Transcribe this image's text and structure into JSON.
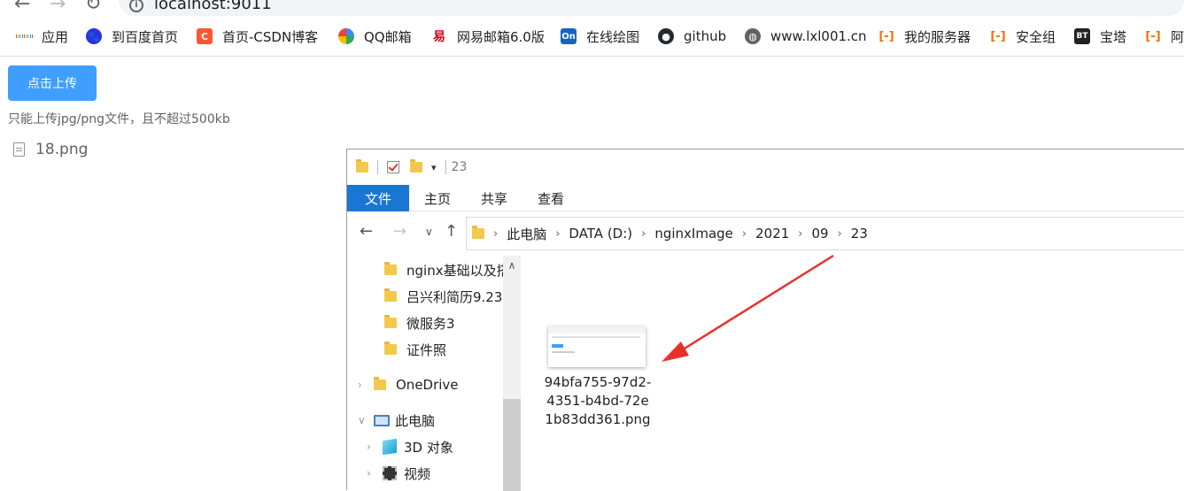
{
  "browser": {
    "url": "localhost:9011",
    "bookmarks": [
      {
        "label": "应用",
        "icon": "apps-grid-icon"
      },
      {
        "label": "到百度首页",
        "icon": "baidu-paw-icon",
        "color": "#2932e1"
      },
      {
        "label": "首页-CSDN博客",
        "icon": "csdn-icon",
        "color": "#fc5531",
        "glyph": "C"
      },
      {
        "label": "QQ邮箱",
        "icon": "qq-mail-icon",
        "color": "#f5a623"
      },
      {
        "label": "网易邮箱6.0版",
        "icon": "netease-mail-icon",
        "color": "#d0021b"
      },
      {
        "label": "在线绘图",
        "icon": "online-draw-icon",
        "color": "#1565c0",
        "glyph": "On"
      },
      {
        "label": "github",
        "icon": "github-icon",
        "color": "#24292e"
      },
      {
        "label": "www.lxl001.cn",
        "icon": "globe-icon",
        "color": "#5f6368"
      },
      {
        "label": "我的服务器",
        "icon": "aliyun-icon",
        "color": "#ff6a00"
      },
      {
        "label": "安全组",
        "icon": "aliyun-icon",
        "color": "#ff6a00"
      },
      {
        "label": "宝塔",
        "icon": "bt-icon",
        "color": "#20a53a",
        "glyph": "BT"
      },
      {
        "label": "阿",
        "icon": "aliyun-icon",
        "color": "#ff6a00"
      }
    ]
  },
  "upload": {
    "button_label": "点击上传",
    "tip": "只能上传jpg/png文件，且不超过500kb",
    "files": [
      "18.png"
    ]
  },
  "explorer": {
    "title": "23",
    "ribbon_tabs": [
      "文件",
      "主页",
      "共享",
      "查看"
    ],
    "active_tab": "文件",
    "breadcrumb": [
      "此电脑",
      "DATA (D:)",
      "nginxImage",
      "2021",
      "09",
      "23"
    ],
    "nav_items": [
      {
        "label": "nginx基础以及搭",
        "type": "folder"
      },
      {
        "label": "吕兴利简历9.23",
        "type": "folder"
      },
      {
        "label": "微服务3",
        "type": "folder"
      },
      {
        "label": "证件照",
        "type": "folder"
      },
      {
        "label": "OneDrive",
        "type": "onedrive"
      },
      {
        "label": "此电脑",
        "type": "pc"
      },
      {
        "label": "3D 对象",
        "type": "3d"
      },
      {
        "label": "视频",
        "type": "video"
      }
    ],
    "file": {
      "name": "94bfa755-97d2-4351-b4bd-72e1b83dd361.png"
    }
  },
  "colors": {
    "primary": "#409eff",
    "ribbon_active": "#1976d2",
    "annotation_arrow": "#e8302b"
  }
}
